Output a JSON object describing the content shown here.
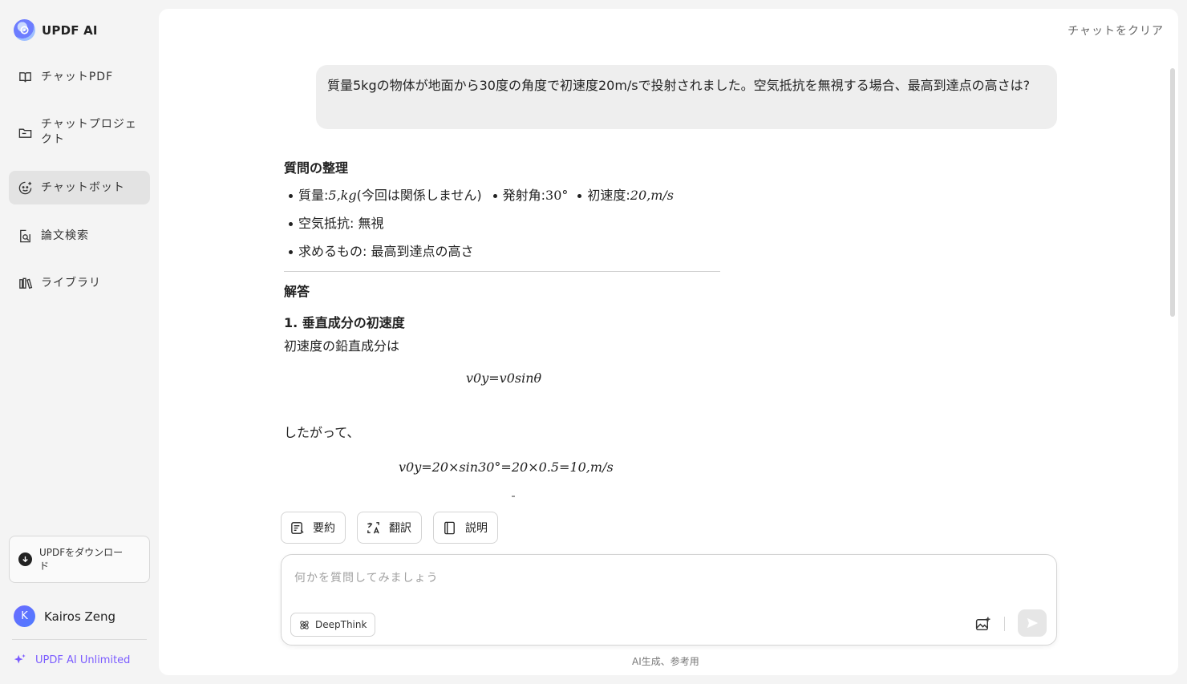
{
  "brand": {
    "name": "UPDF AI"
  },
  "sidebar": {
    "items": [
      {
        "label": "チャットPDF",
        "icon": "book-chat-icon"
      },
      {
        "label": "チャットプロジェクト",
        "icon": "folder-chat-icon"
      },
      {
        "label": "チャットボット",
        "icon": "bot-face-icon",
        "active": true
      },
      {
        "label": "論文検索",
        "icon": "doc-search-icon"
      },
      {
        "label": "ライブラリ",
        "icon": "library-icon"
      }
    ],
    "download_label": "UPDFをダウンロード",
    "user": {
      "initial": "K",
      "name": "Kairos Zeng"
    },
    "plan_label": "UPDF AI Unlimited"
  },
  "header": {
    "clear_label": "チャットをクリア"
  },
  "chat": {
    "user_message": "質量5kgの物体が地面から30度の角度で初速度20m/sで投射されました。空気抵抗を無視する場合、最高到達点の高さは?",
    "answer": {
      "section1_title": "質問の整理",
      "mass_label": "質量: ",
      "mass_value": "5,kg",
      "mass_note": "(今回は関係しません)",
      "angle_label": "発射角: ",
      "angle_value": "30°",
      "velocity_label": "初速度: ",
      "velocity_value": "20,m/s",
      "air_item": "空気抵抗: 無視",
      "goal_item": "求めるもの: 最高到達点の高さ",
      "section2_title": "解答",
      "step1_title": "1. 垂直成分の初速度",
      "step1_text": "初速度の鉛直成分は",
      "eq1": "v0y=v0sinθ",
      "therefore": "したがって、",
      "eq2": "v0y=20×sin30°=20×0.5=10,m/s"
    }
  },
  "quick_actions": [
    {
      "label": "要約",
      "icon": "summary-icon"
    },
    {
      "label": "翻訳",
      "icon": "translate-icon"
    },
    {
      "label": "説明",
      "icon": "book-icon"
    }
  ],
  "input": {
    "placeholder": "何かを質問してみましょう",
    "value": "",
    "deepthink_label": "DeepThink"
  },
  "footer_note": "AI生成、参考用",
  "colors": {
    "accent": "#7b5cff",
    "active_bg": "#e3e3e3",
    "bubble_bg": "#eeeeee"
  }
}
